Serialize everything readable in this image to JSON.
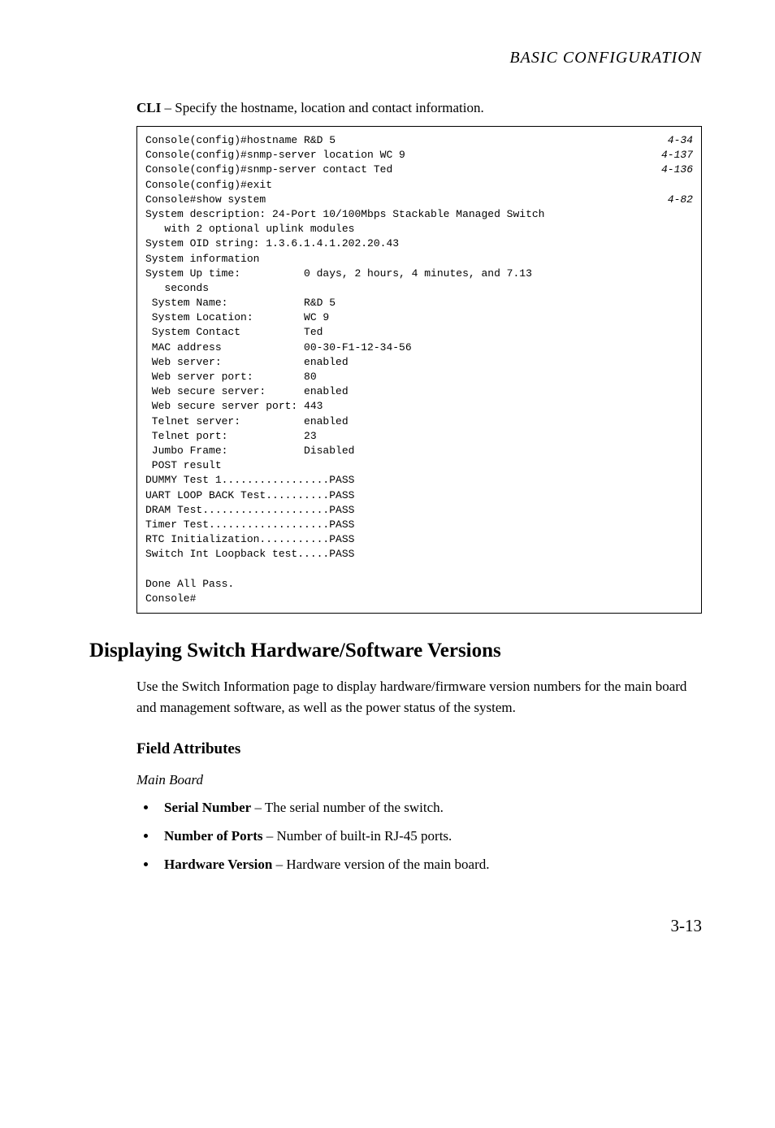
{
  "header": "BASIC CONFIGURATION",
  "intro": {
    "bold": "CLI",
    "rest": " – Specify the hostname, location and contact information."
  },
  "code": {
    "lines": [
      {
        "text": "Console(config)#hostname R&D 5",
        "ref": "4-34"
      },
      {
        "text": "Console(config)#snmp-server location WC 9",
        "ref": "4-137"
      },
      {
        "text": "Console(config)#snmp-server contact Ted",
        "ref": "4-136"
      },
      {
        "text": "Console(config)#exit"
      },
      {
        "text": "Console#show system",
        "ref": "4-82"
      },
      {
        "text": "System description: 24-Port 10/100Mbps Stackable Managed Switch"
      },
      {
        "text": "   with 2 optional uplink modules"
      },
      {
        "text": "System OID string: 1.3.6.1.4.1.202.20.43"
      },
      {
        "text": "System information"
      },
      {
        "text": "System Up time:          0 days, 2 hours, 4 minutes, and 7.13"
      },
      {
        "text": "   seconds"
      },
      {
        "text": " System Name:            R&D 5"
      },
      {
        "text": " System Location:        WC 9"
      },
      {
        "text": " System Contact          Ted"
      },
      {
        "text": " MAC address             00-30-F1-12-34-56"
      },
      {
        "text": " Web server:             enabled"
      },
      {
        "text": " Web server port:        80"
      },
      {
        "text": " Web secure server:      enabled"
      },
      {
        "text": " Web secure server port: 443"
      },
      {
        "text": " Telnet server:          enabled"
      },
      {
        "text": " Telnet port:            23"
      },
      {
        "text": " Jumbo Frame:            Disabled"
      },
      {
        "text": " POST result"
      },
      {
        "text": "DUMMY Test 1.................PASS"
      },
      {
        "text": "UART LOOP BACK Test..........PASS"
      },
      {
        "text": "DRAM Test....................PASS"
      },
      {
        "text": "Timer Test...................PASS"
      },
      {
        "text": "RTC Initialization...........PASS"
      },
      {
        "text": "Switch Int Loopback test.....PASS"
      },
      {
        "text": ""
      },
      {
        "text": "Done All Pass."
      },
      {
        "text": "Console#"
      }
    ]
  },
  "section_heading": "Displaying Switch Hardware/Software Versions",
  "section_body": "Use the Switch Information page to display hardware/firmware version numbers for the main board and management software, as well as the power status of the system.",
  "field_attributes_heading": "Field Attributes",
  "main_board_label": "Main Board",
  "bullets": [
    {
      "bold": "Serial Number",
      "rest": " – The serial number of the switch."
    },
    {
      "bold": "Number of Ports",
      "rest": " – Number of built-in RJ-45 ports."
    },
    {
      "bold": "Hardware Version",
      "rest": " – Hardware version of the main board."
    }
  ],
  "page_number": "3-13"
}
